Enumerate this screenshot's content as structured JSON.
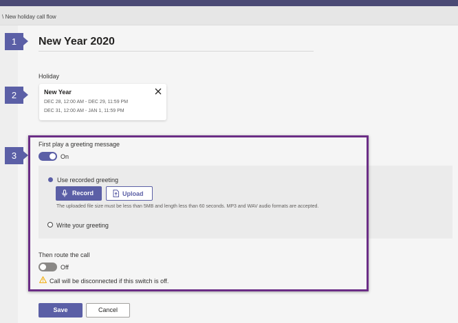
{
  "breadcrumb": "\\ New holiday call flow",
  "steps": [
    "1",
    "2",
    "3"
  ],
  "page_title": "New Year 2020",
  "holiday": {
    "label": "Holiday",
    "name": "New Year",
    "ranges": [
      "DEC 28, 12:00 AM - DEC 29, 11:59 PM",
      "DEC 31, 12:00 AM - JAN 1, 11:59 PM"
    ]
  },
  "greeting": {
    "label": "First play a greeting message",
    "toggle_state": "On",
    "option_recorded": "Use recorded greeting",
    "record_label": "Record",
    "upload_label": "Upload",
    "hint": "The uploaded file size must be less than 5MB and length less than 60 seconds. MP3 and WAV audio formats are accepted.",
    "option_write": "Write your greeting"
  },
  "route": {
    "label": "Then route the call",
    "toggle_state": "Off",
    "warning": "Call will be disconnected if this switch is off."
  },
  "actions": {
    "save": "Save",
    "cancel": "Cancel"
  },
  "colors": {
    "accent": "#5b5fa6",
    "highlight_border": "#6b2d86",
    "warning": "#f2a900"
  }
}
